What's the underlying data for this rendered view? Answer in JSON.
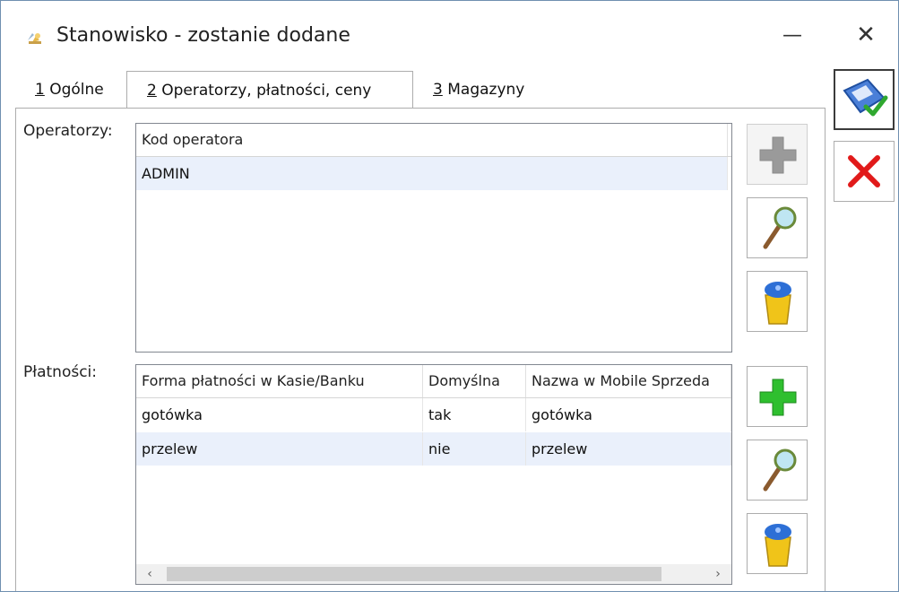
{
  "window": {
    "title": "Stanowisko - zostanie dodane",
    "icon": "station-icon",
    "minimize_glyph": "—",
    "close_glyph": "✕"
  },
  "tabs": [
    {
      "key": "1",
      "label": " Ogólne",
      "active": false
    },
    {
      "key": "2",
      "label": " Operatorzy, płatności, ceny",
      "active": true
    },
    {
      "key": "3",
      "label": " Magazyny",
      "active": false
    }
  ],
  "operators": {
    "label": "Operatorzy:",
    "columns": [
      "Kod operatora"
    ],
    "rows": [
      [
        "ADMIN"
      ]
    ]
  },
  "payments": {
    "label": "Płatności:",
    "columns": [
      "Forma płatności w Kasie/Banku",
      "Domyślna",
      "Nazwa w Mobile Sprzeda"
    ],
    "rows": [
      [
        "gotówka",
        "tak",
        "gotówka"
      ],
      [
        "przelew",
        "nie",
        "przelew"
      ]
    ],
    "scroll_left": "‹",
    "scroll_right": "›"
  },
  "icons": {
    "add": "plus-icon",
    "edit": "magnifier-icon",
    "delete": "trash-icon",
    "save": "save-icon",
    "cancel": "cancel-icon"
  },
  "colors": {
    "border": "#adadad",
    "selected_row": "#eaf0fb",
    "plus_green": "#2fbf2f",
    "cancel_red": "#e11a1a"
  }
}
